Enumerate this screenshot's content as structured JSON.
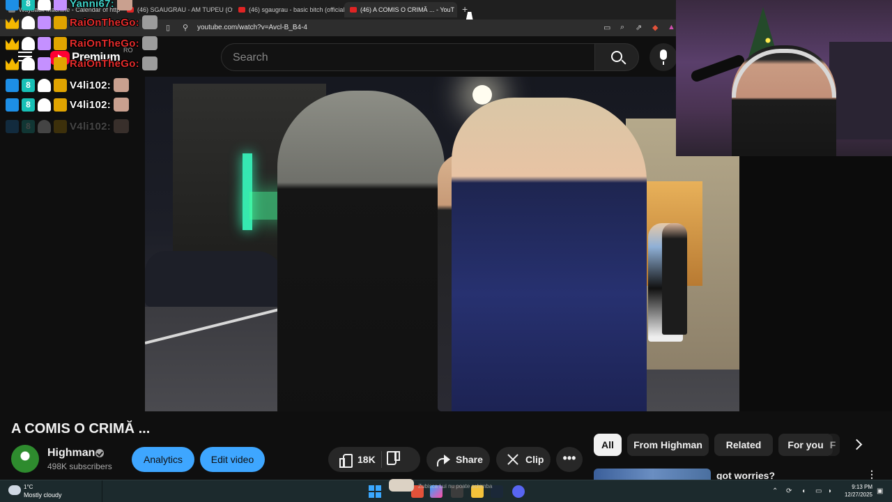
{
  "browser": {
    "tabs": [
      {
        "label": "Wayback Machine - Calendar of http"
      },
      {
        "label": "(46) SGAUGRAU - AM TUPEU (Offici"
      },
      {
        "label": "(46) sgaugrau - basic bitch (official vi"
      },
      {
        "label": "(46) A COMIS O CRIMĂ ... - YouT",
        "active": true
      }
    ],
    "close_glyph": "✕",
    "new_tab_glyph": "+",
    "url": "youtube.com/watch?v=Avcl-B_B4-4"
  },
  "youtube": {
    "logo_word": "Premium",
    "country_code": "RO",
    "search_placeholder": "Search",
    "video": {
      "title": "A COMIS O CRIMĂ ...",
      "channel": "Highman",
      "subscribers": "498K subscribers",
      "analytics_label": "Analytics",
      "edit_label": "Edit video",
      "likes": "18K",
      "share_label": "Share",
      "clip_label": "Clip",
      "more_glyph": "•••"
    },
    "chips": [
      "All",
      "From Highman",
      "Related",
      "For you",
      "F"
    ],
    "recommendation": {
      "title": "got worries?",
      "menu_glyph": "⋮"
    }
  },
  "chat": [
    {
      "name": "Yanni67:",
      "color": "#3ed1c7"
    },
    {
      "name": "RaiOnTheGo:",
      "color": "#e22b2b"
    },
    {
      "name": "RaiOnTheGo:",
      "color": "#e22b2b"
    },
    {
      "name": "RaiOnTheGo:",
      "color": "#e22b2b"
    },
    {
      "name": "V4li102:",
      "color": "#ffffff"
    },
    {
      "name": "V4li102:",
      "color": "#ffffff"
    },
    {
      "name": "V4li102:",
      "color": "#ffffff"
    }
  ],
  "taskbar": {
    "weather_temp": "1°C",
    "weather_desc": "Mostly cloudy",
    "media_notice": "Zubisca Lui nu poate schimba",
    "time": "9:13 PM",
    "date": "12/27/2025"
  }
}
